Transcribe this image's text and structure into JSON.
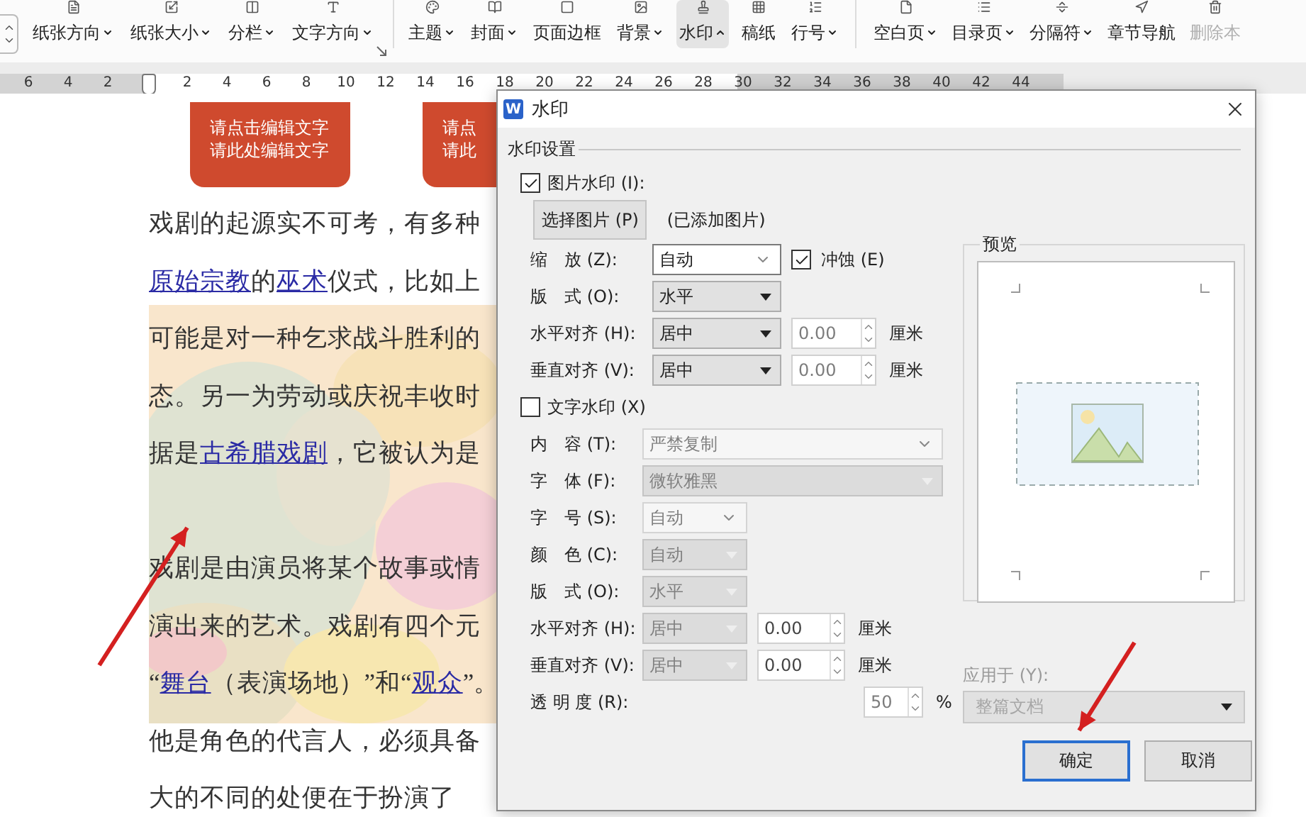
{
  "ribbon": {
    "groups": [
      {
        "items": [
          {
            "label": "纸张方向",
            "dropdown": true,
            "expanded": false,
            "selected": false,
            "disabled": false
          },
          {
            "label": "纸张大小",
            "dropdown": true,
            "expanded": false,
            "selected": false,
            "disabled": false
          },
          {
            "label": "分栏",
            "dropdown": true,
            "expanded": false,
            "selected": false,
            "disabled": false
          },
          {
            "label": "文字方向",
            "dropdown": true,
            "expanded": false,
            "selected": false,
            "disabled": false
          }
        ],
        "launcher": true
      },
      {
        "items": [
          {
            "label": "主题",
            "dropdown": true,
            "expanded": false,
            "selected": false,
            "disabled": false
          },
          {
            "label": "封面",
            "dropdown": true,
            "expanded": false,
            "selected": false,
            "disabled": false
          },
          {
            "label": "页面边框",
            "dropdown": false,
            "selected": false,
            "disabled": false
          },
          {
            "label": "背景",
            "dropdown": true,
            "expanded": false,
            "selected": false,
            "disabled": false
          },
          {
            "label": "水印",
            "dropdown": true,
            "expanded": true,
            "selected": true,
            "disabled": false
          },
          {
            "label": "稿纸",
            "dropdown": false,
            "selected": false,
            "disabled": false
          },
          {
            "label": "行号",
            "dropdown": true,
            "expanded": false,
            "selected": false,
            "disabled": false
          }
        ]
      },
      {
        "items": [
          {
            "label": "空白页",
            "dropdown": true,
            "expanded": false,
            "selected": false,
            "disabled": false
          },
          {
            "label": "目录页",
            "dropdown": true,
            "expanded": false,
            "selected": false,
            "disabled": false
          },
          {
            "label": "分隔符",
            "dropdown": true,
            "expanded": false,
            "selected": false,
            "disabled": false
          },
          {
            "label": "章节导航",
            "dropdown": false,
            "selected": false,
            "disabled": false
          },
          {
            "label": "删除本",
            "dropdown": false,
            "selected": false,
            "disabled": true
          }
        ]
      }
    ]
  },
  "ruler": {
    "left_ticks": [
      "6",
      "4",
      "2"
    ],
    "right_ticks": [
      "2",
      "4",
      "6",
      "8",
      "10",
      "12",
      "14",
      "16",
      "18",
      "20",
      "22",
      "24",
      "26",
      "28",
      "30",
      "32",
      "34",
      "36",
      "38",
      "40",
      "42",
      "44"
    ]
  },
  "document": {
    "text_boxes": [
      {
        "lines": [
          "请点击编辑文字",
          "请此处编辑文字"
        ]
      },
      {
        "lines": [
          "请点",
          "请此"
        ]
      }
    ],
    "paragraphs": [
      {
        "lines": [
          [
            {
              "text": "戏剧的起源实不可考，有多种",
              "link": false
            }
          ],
          [
            {
              "text": "原始宗教",
              "link": true
            },
            {
              "text": "的",
              "link": false
            },
            {
              "text": "巫术",
              "link": true
            },
            {
              "text": "仪式，比如上",
              "link": false
            }
          ],
          [
            {
              "text": "可能是对一种乞求战斗胜利的",
              "link": false
            }
          ],
          [
            {
              "text": "态。另一为劳动或庆祝丰收时",
              "link": false
            }
          ],
          [
            {
              "text": "据是",
              "link": false
            },
            {
              "text": "古希腊戏剧",
              "link": true
            },
            {
              "text": "，它被认为是",
              "link": false
            }
          ]
        ]
      },
      {
        "lines": [
          [
            {
              "text": "戏剧是由演员将某个故事或情",
              "link": false
            }
          ],
          [
            {
              "text": "演出来的艺术。戏剧有四个元",
              "link": false
            }
          ],
          [
            {
              "text": "“",
              "link": false
            },
            {
              "text": "舞台",
              "link": true
            },
            {
              "text": "（表演场地）”和“",
              "link": false
            },
            {
              "text": "观众",
              "link": true
            },
            {
              "text": "”。",
              "link": false
            }
          ],
          [
            {
              "text": "他是角色的代言人，必须具备",
              "link": false
            }
          ],
          [
            {
              "text": "大的不同的处便在于扮演了",
              "link": false
            }
          ]
        ]
      }
    ]
  },
  "dialog": {
    "app_icon": "W",
    "title": "水印",
    "section": "水印设置",
    "picture_watermark": {
      "label": "图片水印 (I):",
      "checked": true,
      "choose_button": "选择图片 (P)",
      "status": "(已添加图片)",
      "fields": [
        {
          "label": "缩　放 (Z):",
          "kind": "combo",
          "value": "自动",
          "disabled": false,
          "checkbox": {
            "label": "冲蚀 (E)",
            "checked": true
          }
        },
        {
          "label": "版　式 (O):",
          "kind": "select",
          "value": "水平",
          "disabled": false
        },
        {
          "label": "水平对齐 (H):",
          "kind": "select",
          "value": "居中",
          "disabled": false,
          "offset": {
            "value": "0.00",
            "unit": "厘米",
            "disabled": true
          }
        },
        {
          "label": "垂直对齐 (V):",
          "kind": "select",
          "value": "居中",
          "disabled": false,
          "offset": {
            "value": "0.00",
            "unit": "厘米",
            "disabled": true
          }
        }
      ]
    },
    "text_watermark": {
      "label": "文字水印 (X)",
      "checked": false,
      "fields": [
        {
          "label": "内　容 (T):",
          "kind": "wide-combo",
          "value": "严禁复制",
          "disabled": true
        },
        {
          "label": "字　体 (F):",
          "kind": "wide-select",
          "value": "微软雅黑",
          "disabled": true
        },
        {
          "label": "字　号 (S):",
          "kind": "combo",
          "value": "自动",
          "disabled": true
        },
        {
          "label": "颜　色 (C):",
          "kind": "select",
          "value": "自动",
          "disabled": true
        },
        {
          "label": "版　式 (O):",
          "kind": "select",
          "value": "水平",
          "disabled": true
        },
        {
          "label": "水平对齐 (H):",
          "kind": "select",
          "value": "居中",
          "disabled": true,
          "offset": {
            "value": "0.00",
            "unit": "厘米",
            "disabled": false
          }
        },
        {
          "label": "垂直对齐 (V):",
          "kind": "select",
          "value": "居中",
          "disabled": true,
          "offset": {
            "value": "0.00",
            "unit": "厘米",
            "disabled": false
          }
        },
        {
          "label": "透 明 度 (R):",
          "kind": "spin",
          "offset": {
            "value": "50",
            "unit": "%",
            "disabled": true
          }
        }
      ]
    },
    "preview": {
      "title": "预览"
    },
    "apply_to": {
      "label": "应用于 (Y):",
      "value": "整篇文档",
      "disabled": true
    },
    "buttons": [
      {
        "label": "确定",
        "default": true
      },
      {
        "label": "取消",
        "default": false
      }
    ]
  }
}
